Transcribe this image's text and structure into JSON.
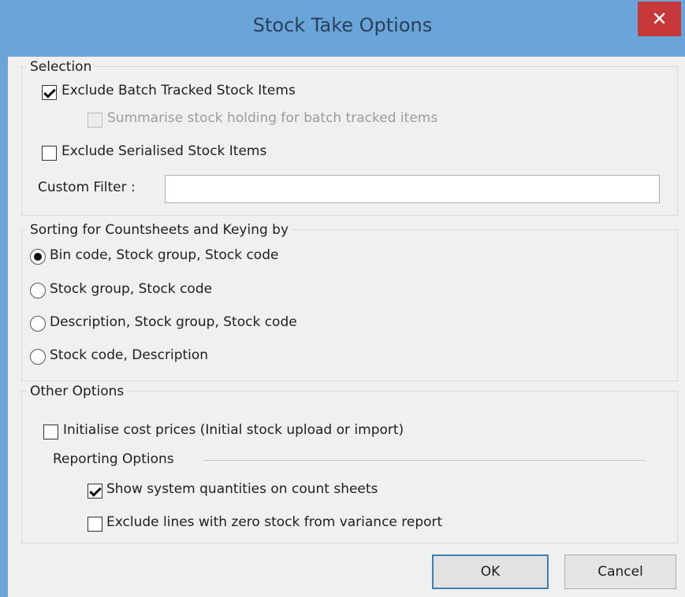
{
  "window": {
    "title": "Stock Take Options",
    "close_glyph": "✕"
  },
  "selection": {
    "legend": "Selection",
    "exclude_batch": {
      "label": "Exclude Batch Tracked Stock Items",
      "checked": true
    },
    "summarise_batch": {
      "label": "Summarise stock holding for batch tracked items",
      "checked": false,
      "enabled": false
    },
    "exclude_serialised": {
      "label": "Exclude Serialised Stock Items",
      "checked": false
    },
    "custom_filter": {
      "label": "Custom Filter :",
      "value": ""
    }
  },
  "sorting": {
    "legend": "Sorting for Countsheets and Keying by",
    "options": [
      {
        "label": "Bin code, Stock group, Stock code",
        "selected": true
      },
      {
        "label": "Stock group, Stock code",
        "selected": false
      },
      {
        "label": "Description, Stock group, Stock code",
        "selected": false
      },
      {
        "label": "Stock code, Description",
        "selected": false
      }
    ]
  },
  "other": {
    "legend": "Other Options",
    "initialise_cost": {
      "label": "Initialise cost prices (Initial stock upload or import)",
      "checked": false
    },
    "reporting_legend": "Reporting Options",
    "show_system_qty": {
      "label": "Show system quantities on count sheets",
      "checked": true
    },
    "exclude_zero": {
      "label": "Exclude lines with zero stock from variance report",
      "checked": false
    }
  },
  "buttons": {
    "ok": "OK",
    "cancel": "Cancel"
  }
}
